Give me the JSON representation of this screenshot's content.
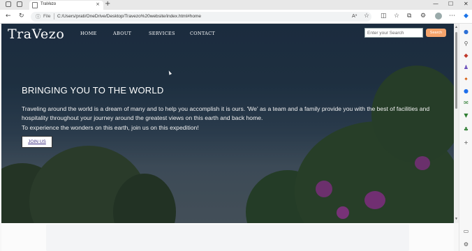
{
  "browser": {
    "tab_title": "TraVezo",
    "tab_close": "×",
    "new_tab": "+",
    "address_file_label": "File",
    "address_url": "C:/Users/prati/OneDrive/Desktop/Travezo%20website/index.html#home",
    "reader_icon": "Aᵃ",
    "controls": {
      "minimize": "—",
      "maximize": "☐",
      "close": "✕"
    }
  },
  "site": {
    "logo": "TraVezo",
    "nav": [
      {
        "label": "HOME"
      },
      {
        "label": "ABOUT"
      },
      {
        "label": "SERVICES"
      },
      {
        "label": "CONTACT"
      }
    ],
    "search": {
      "placeholder": "Enter your Search",
      "button": "Search"
    },
    "hero": {
      "title": "BRINGING YOU TO THE WORLD",
      "paragraph_1": "Traveling around the world is a dream of many and to help you accomplish it is ours. 'We' as a team and a family provide you with the best of facilities and hospitality throughout your journey around the greatest views on this earth and back home.",
      "paragraph_2": "To experience the wonders on this earth, join us on this expedition!",
      "cta": "JOIN US"
    }
  },
  "colors": {
    "accent_button": "#f5a46c",
    "hero_bg": "#24394a",
    "join_text": "#3a2a80"
  }
}
